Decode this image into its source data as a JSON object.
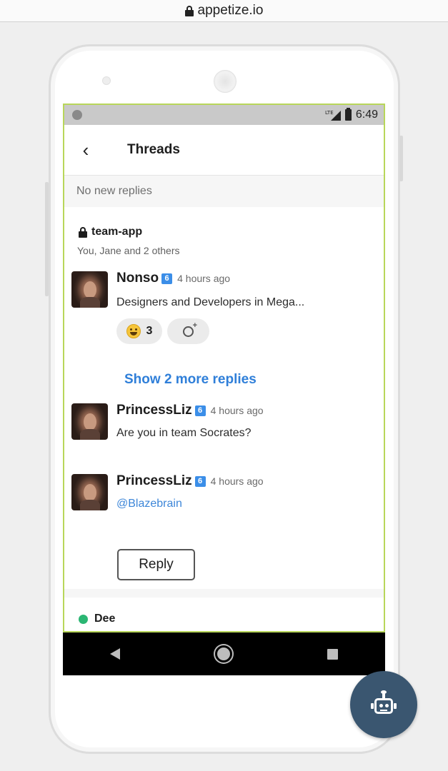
{
  "browser": {
    "url": "appetize.io"
  },
  "status_bar": {
    "network": "LTE",
    "time": "6:49"
  },
  "app_bar": {
    "back_icon": "back-chevron-icon",
    "back_glyph": "‹",
    "title": "Threads"
  },
  "banner": {
    "text": "No new replies"
  },
  "thread": {
    "channel": "team-app",
    "participants": "You, Jane and 2 others",
    "messages": [
      {
        "author": "Nonso",
        "badge": "6",
        "time": "4 hours ago",
        "text": "Designers and Developers in Mega...",
        "reactions": [
          {
            "emoji": "grinning-face",
            "count": "3"
          }
        ]
      },
      {
        "author": "PrincessLiz",
        "badge": "6",
        "time": "4 hours ago",
        "text": "Are you in team Socrates?"
      },
      {
        "author": "PrincessLiz",
        "badge": "6",
        "time": "4 hours ago",
        "text": "@Blazebrain"
      }
    ],
    "show_more_label": "Show 2 more replies",
    "reply_label": "Reply"
  },
  "next_thread": {
    "name": "Dee",
    "status_color": "#2bb673"
  },
  "colors": {
    "accent_link": "#2f7fd9",
    "screen_border": "#b8d65a",
    "fab": "#3a5670"
  },
  "fab": {
    "icon": "robot-icon"
  }
}
